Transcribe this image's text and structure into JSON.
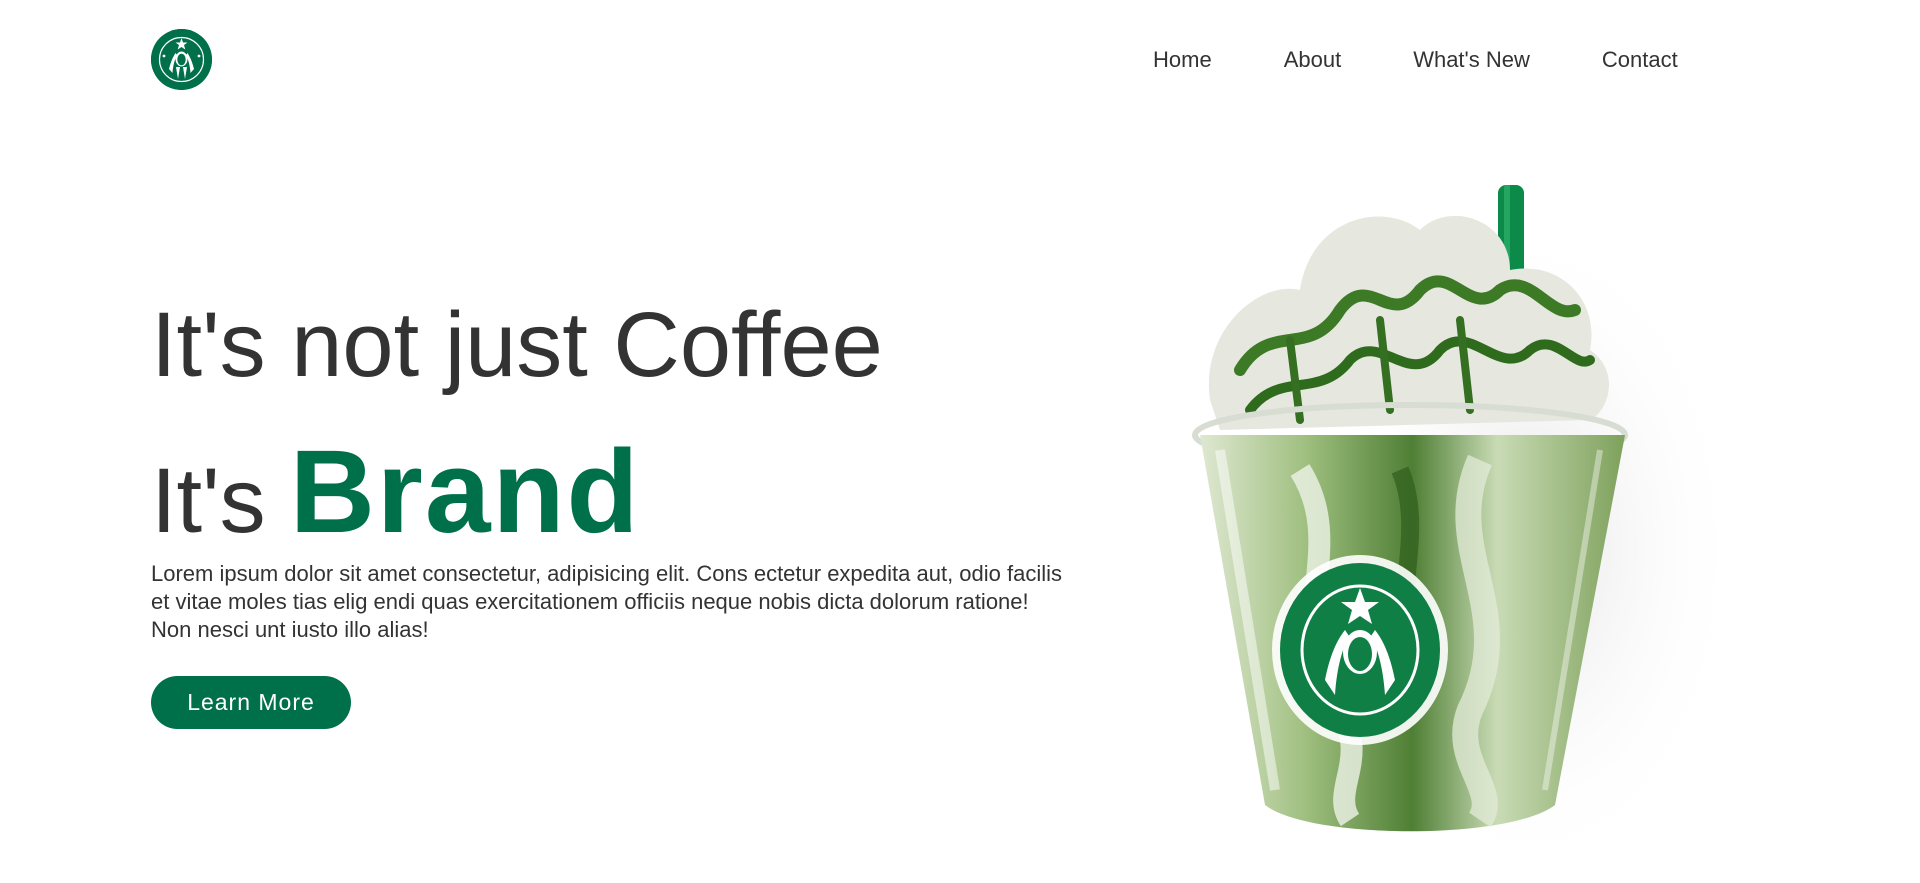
{
  "header": {
    "logo_icon": "starbucks-siren-logo",
    "nav": [
      {
        "label": "Home"
      },
      {
        "label": "About"
      },
      {
        "label": "What's New"
      },
      {
        "label": "Contact"
      }
    ]
  },
  "hero": {
    "headline_line1": "It's not just Coffee",
    "headline_line2_prefix": "It's",
    "headline_line2_brand": "Brand",
    "description": "Lorem ipsum dolor sit amet consectetur, adipisicing elit. Cons ectetur expedita aut, odio facilis et vitae moles tias elig endi quas exercitationem officiis neque nobis dicta dolorum ratione! Non nesci unt iusto illo alias!",
    "cta_label": "Learn More"
  },
  "product_image": {
    "icon": "matcha-frappuccino-cup"
  },
  "colors": {
    "brand_green": "#00704a",
    "text": "#333333",
    "background": "#ffffff"
  }
}
